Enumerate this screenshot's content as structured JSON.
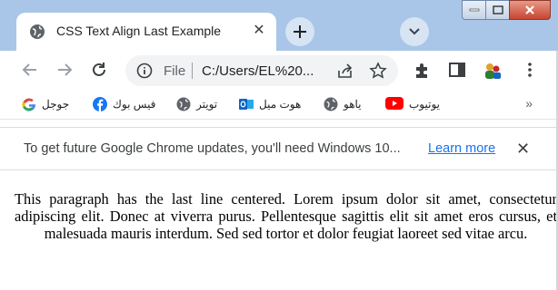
{
  "window": {
    "controls": {
      "minimize": "minimize",
      "maximize": "maximize",
      "close": "close"
    }
  },
  "tab": {
    "title": "CSS Text Align Last Example",
    "close_glyph": "✕",
    "icon": "globe-icon"
  },
  "toolbar": {
    "omnibox": {
      "scheme_label": "File",
      "url": "C:/Users/EL%20..."
    },
    "icons": [
      "back-icon",
      "forward-icon",
      "reload-icon",
      "info-icon",
      "share-icon",
      "star-icon",
      "extensions-icon",
      "sidepanel-icon",
      "profile-icon",
      "menu-icon"
    ]
  },
  "bookmarks": {
    "items": [
      {
        "label": "جوجل",
        "icon": "google-icon"
      },
      {
        "label": "فيس بوك",
        "icon": "facebook-icon"
      },
      {
        "label": "تويتر",
        "icon": "globe-icon"
      },
      {
        "label": "هوت ميل",
        "icon": "outlook-icon"
      },
      {
        "label": "ياهو",
        "icon": "globe-icon"
      },
      {
        "label": "يوتيوب",
        "icon": "youtube-icon"
      }
    ],
    "more_glyph": "»"
  },
  "infobar": {
    "message": "To get future Google Chrome updates, you'll need Windows 10...",
    "link": "Learn more",
    "close_glyph": "✕"
  },
  "page": {
    "paragraph": "This paragraph has the last line centered. Lorem ipsum dolor sit amet, consectetur adipiscing elit. Donec at viverra purus. Pellentesque sagittis elit sit amet eros cursus, et malesuada mauris interdum. Sed sed tortor et dolor feugiat laoreet sed vitae arcu."
  },
  "colors": {
    "tabstrip": "#a9c6e8",
    "link": "#1a73e8",
    "facebook": "#1877f2",
    "youtube": "#ff0000",
    "outlook": "#0a64c8"
  }
}
